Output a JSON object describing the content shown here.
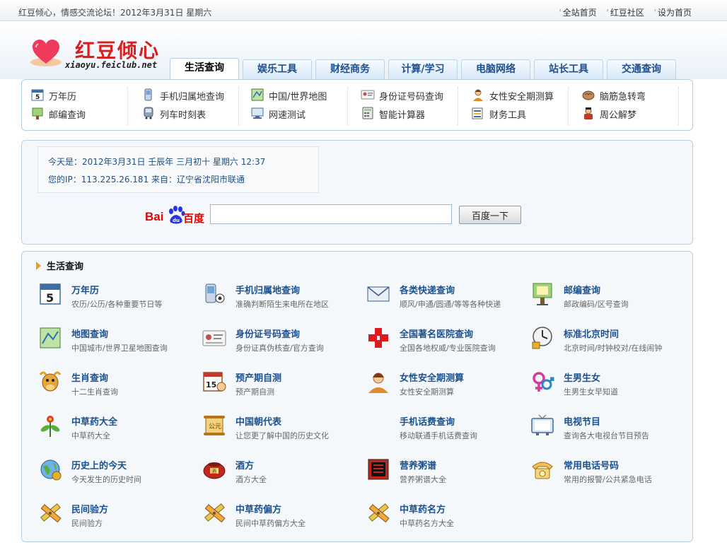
{
  "topbar": {
    "welcome": "红豆倾心，情感交流论坛！2012年3月31日 星期六",
    "links": [
      "全站首页",
      "红豆社区",
      "设为首页"
    ]
  },
  "logo": {
    "brand": "红豆倾心",
    "domain": "xiaoyu.feiclub.net"
  },
  "tabs": [
    "生活查询",
    "娱乐工具",
    "财经商务",
    "计算/学习",
    "电脑网络",
    "站长工具",
    "交通查询"
  ],
  "quick_links": [
    {
      "label": "万年历",
      "icon": "calendar-icon"
    },
    {
      "label": "邮编查询",
      "icon": "post-icon"
    },
    {
      "label": "手机归属地查询",
      "icon": "phone-icon"
    },
    {
      "label": "列车时刻表",
      "icon": "train-icon"
    },
    {
      "label": "中国/世界地图",
      "icon": "map-icon"
    },
    {
      "label": "网速测试",
      "icon": "network-icon"
    },
    {
      "label": "身份证号码查询",
      "icon": "id-card-icon"
    },
    {
      "label": "智能计算器",
      "icon": "calculator-icon"
    },
    {
      "label": "女性安全期测算",
      "icon": "woman-icon"
    },
    {
      "label": "财务工具",
      "icon": "finance-icon"
    },
    {
      "label": "脑筋急转弯",
      "icon": "brain-icon"
    },
    {
      "label": "周公解梦",
      "icon": "dream-icon"
    }
  ],
  "info": {
    "date_line": "今天是：2012年3月31日   壬辰年 三月初十   星期六   12:37",
    "ip_line": "您的IP：113.225.26.181   来自：辽宁省沈阳市联通"
  },
  "search": {
    "logo_bai": "Bai",
    "logo_du": "百度",
    "input_value": "",
    "button_label": "百度一下"
  },
  "life": {
    "title": "生活查询",
    "items": [
      {
        "title": "万年历",
        "desc": "农历/公历/各种重要节日等",
        "icon": "calendar-icon"
      },
      {
        "title": "手机归属地查询",
        "desc": "准确判断陌生来电所在地区",
        "icon": "phone-icon"
      },
      {
        "title": "各类快递查询",
        "desc": "顺风/申通/圆通/等等各种快递",
        "icon": "envelope-icon"
      },
      {
        "title": "邮编查询",
        "desc": "邮政编码/区号查询",
        "icon": "post-icon"
      },
      {
        "title": "地图查询",
        "desc": "中国城市/世界卫星地图查询",
        "icon": "map-icon"
      },
      {
        "title": "身份证号码查询",
        "desc": "身份证真伪核查/官方查询",
        "icon": "id-card-icon"
      },
      {
        "title": "全国著名医院查询",
        "desc": "全国各地权威/专业医院查询",
        "icon": "hospital-icon"
      },
      {
        "title": "标准北京时间",
        "desc": "北京时间/时钟校对/在线闹钟",
        "icon": "clock-icon"
      },
      {
        "title": "生肖查询",
        "desc": "十二生肖查询",
        "icon": "ox-icon"
      },
      {
        "title": "预产期自测",
        "desc": "预产期自测",
        "icon": "calendar-baby-icon"
      },
      {
        "title": "女性安全期测算",
        "desc": "女性安全期测算",
        "icon": "woman-icon"
      },
      {
        "title": "生男生女",
        "desc": "生男生女早知道",
        "icon": "gender-icon"
      },
      {
        "title": "中草药大全",
        "desc": "中草药大全",
        "icon": "herb-icon"
      },
      {
        "title": "中国朝代表",
        "desc": "让您更了解中国的历史文化",
        "icon": "scroll-icon"
      },
      {
        "title": "手机话费查询",
        "desc": "移动联通手机话费查询",
        "icon": ""
      },
      {
        "title": "电视节目",
        "desc": "查询各大电视台节目预告",
        "icon": "tv-icon"
      },
      {
        "title": "历史上的今天",
        "desc": "今天发生的历史时间",
        "icon": "globe-icon"
      },
      {
        "title": "酒方",
        "desc": "酒方大全",
        "icon": "wine-icon"
      },
      {
        "title": "营养粥谱",
        "desc": "营养粥谱大全",
        "icon": "porridge-icon"
      },
      {
        "title": "常用电话号码",
        "desc": "常用的报警/公共紧急电话",
        "icon": "telephone-icon"
      },
      {
        "title": "民间验方",
        "desc": "民间验方",
        "icon": "pencil-ruler-icon"
      },
      {
        "title": "中草药偏方",
        "desc": "民间中草药偏方大全",
        "icon": "pencil-ruler-icon"
      },
      {
        "title": "中草药名方",
        "desc": "中草药名方大全",
        "icon": "pencil-ruler-icon"
      }
    ]
  }
}
